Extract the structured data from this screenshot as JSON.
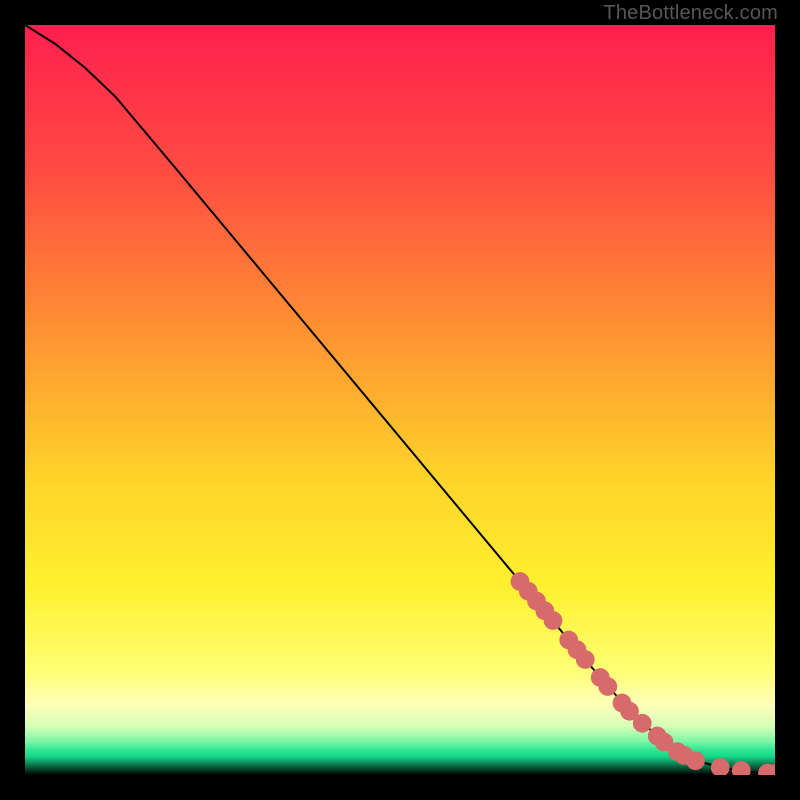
{
  "watermark": "TheBottleneck.com",
  "chart_data": {
    "type": "line",
    "title": "",
    "xlabel": "",
    "ylabel": "",
    "xlim": [
      0,
      100
    ],
    "ylim": [
      0,
      100
    ],
    "grid": false,
    "legend": false,
    "background_gradient_stops": [
      {
        "offset": 0.0,
        "color": "#ff1f4e"
      },
      {
        "offset": 0.2,
        "color": "#ff4d42"
      },
      {
        "offset": 0.4,
        "color": "#ff8f33"
      },
      {
        "offset": 0.6,
        "color": "#ffd22a"
      },
      {
        "offset": 0.75,
        "color": "#fff12f"
      },
      {
        "offset": 0.86,
        "color": "#ffff73"
      },
      {
        "offset": 0.905,
        "color": "#ffffb8"
      },
      {
        "offset": 0.935,
        "color": "#d6ffb8"
      },
      {
        "offset": 0.955,
        "color": "#7ef7a5"
      },
      {
        "offset": 0.968,
        "color": "#28e492"
      },
      {
        "offset": 0.975,
        "color": "#16d98a"
      },
      {
        "offset": 1.0,
        "color": "#000000"
      }
    ],
    "curve": {
      "x": [
        0,
        4,
        8,
        12,
        20,
        30,
        40,
        50,
        60,
        66,
        70,
        74,
        78,
        82,
        86,
        88,
        90,
        92,
        94,
        96,
        98,
        100
      ],
      "y": [
        100,
        97.5,
        94.3,
        90.5,
        81,
        69,
        57,
        45,
        33,
        25.8,
        21,
        16.2,
        11.5,
        7.2,
        3.8,
        2.6,
        1.8,
        1.2,
        0.8,
        0.5,
        0.3,
        0.2
      ]
    },
    "markers": {
      "color": "#d76a6a",
      "radius_frac": 0.0125,
      "points": [
        {
          "x": 66.0,
          "y": 25.8
        },
        {
          "x": 67.1,
          "y": 24.5
        },
        {
          "x": 68.2,
          "y": 23.2
        },
        {
          "x": 69.3,
          "y": 21.9
        },
        {
          "x": 70.4,
          "y": 20.6
        },
        {
          "x": 72.5,
          "y": 18.0
        },
        {
          "x": 73.6,
          "y": 16.7
        },
        {
          "x": 74.7,
          "y": 15.4
        },
        {
          "x": 76.7,
          "y": 13.0
        },
        {
          "x": 77.7,
          "y": 11.8
        },
        {
          "x": 79.6,
          "y": 9.6
        },
        {
          "x": 80.6,
          "y": 8.5
        },
        {
          "x": 82.3,
          "y": 6.9
        },
        {
          "x": 84.3,
          "y": 5.2
        },
        {
          "x": 85.2,
          "y": 4.4
        },
        {
          "x": 87.0,
          "y": 3.1
        },
        {
          "x": 87.9,
          "y": 2.6
        },
        {
          "x": 89.4,
          "y": 1.9
        },
        {
          "x": 92.7,
          "y": 1.0
        },
        {
          "x": 95.5,
          "y": 0.6
        },
        {
          "x": 99.0,
          "y": 0.25
        },
        {
          "x": 100.0,
          "y": 0.2
        }
      ]
    }
  }
}
